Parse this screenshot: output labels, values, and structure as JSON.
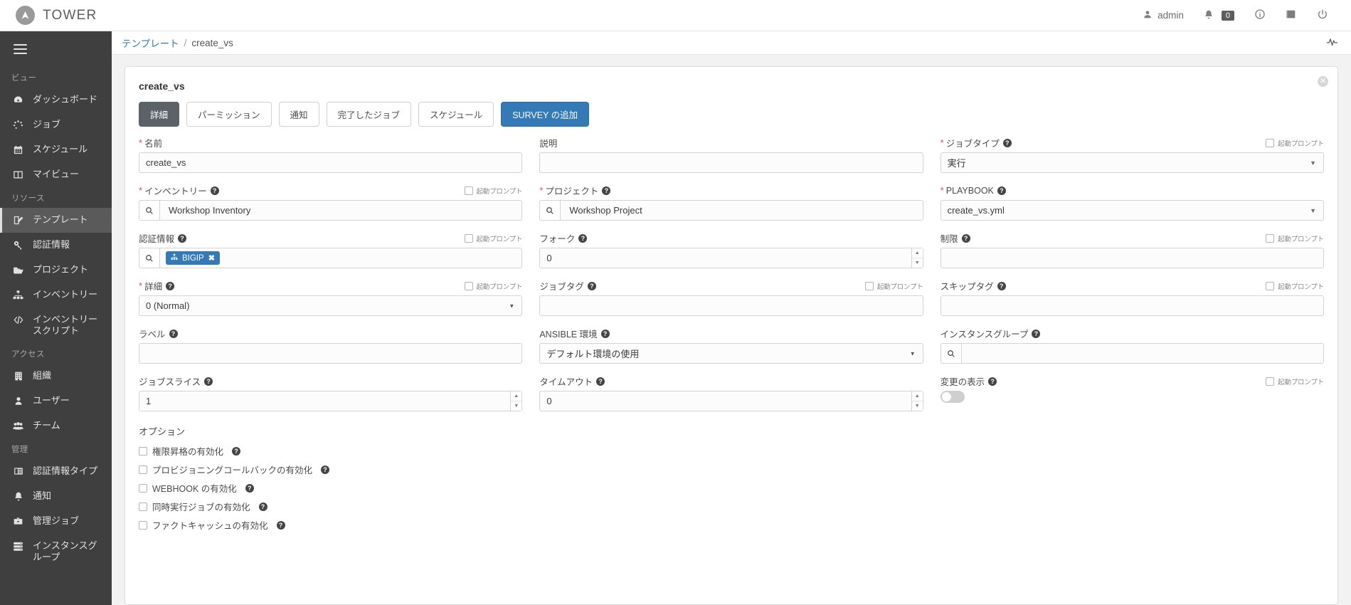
{
  "topbar": {
    "brand": "TOWER",
    "user": "admin",
    "notifications_count": "0",
    "icons": [
      "user-icon",
      "bell-icon",
      "info-icon",
      "book-icon",
      "power-icon"
    ]
  },
  "breadcrumb": {
    "root": "テンプレート",
    "separator": "/",
    "current": "create_vs"
  },
  "sidebar": {
    "sections": [
      {
        "label": "ビュー",
        "items": [
          {
            "label": "ダッシュボード",
            "icon": "dashboard-icon",
            "active": false
          },
          {
            "label": "ジョブ",
            "icon": "jobs-icon",
            "active": false
          },
          {
            "label": "スケジュール",
            "icon": "calendar-icon",
            "active": false
          },
          {
            "label": "マイビュー",
            "icon": "myview-icon",
            "active": false
          }
        ]
      },
      {
        "label": "リソース",
        "items": [
          {
            "label": "テンプレート",
            "icon": "template-icon",
            "active": true
          },
          {
            "label": "認証情報",
            "icon": "key-icon",
            "active": false
          },
          {
            "label": "プロジェクト",
            "icon": "folder-icon",
            "active": false
          },
          {
            "label": "インベントリー",
            "icon": "sitemap-icon",
            "active": false
          },
          {
            "label": "インベントリースクリプト",
            "icon": "code-icon",
            "active": false
          }
        ]
      },
      {
        "label": "アクセス",
        "items": [
          {
            "label": "組織",
            "icon": "building-icon",
            "active": false
          },
          {
            "label": "ユーザー",
            "icon": "user-icon",
            "active": false
          },
          {
            "label": "チーム",
            "icon": "team-icon",
            "active": false
          }
        ]
      },
      {
        "label": "管理",
        "items": [
          {
            "label": "認証情報タイプ",
            "icon": "credential-type-icon",
            "active": false
          },
          {
            "label": "通知",
            "icon": "bell-icon",
            "active": false
          },
          {
            "label": "管理ジョブ",
            "icon": "briefcase-icon",
            "active": false
          },
          {
            "label": "インスタンスグループ",
            "icon": "server-icon",
            "active": false
          }
        ]
      }
    ]
  },
  "card": {
    "title": "create_vs",
    "tabs": [
      {
        "label": "詳細",
        "style": "active"
      },
      {
        "label": "パーミッション",
        "style": "default"
      },
      {
        "label": "通知",
        "style": "default"
      },
      {
        "label": "完了したジョブ",
        "style": "default"
      },
      {
        "label": "スケジュール",
        "style": "default"
      },
      {
        "label": "SURVEY の追加",
        "style": "primary"
      }
    ],
    "prompt_label": "起動プロンプト",
    "fields": {
      "name": {
        "label": "名前",
        "value": "create_vs"
      },
      "description": {
        "label": "説明",
        "value": ""
      },
      "job_type": {
        "label": "ジョブタイプ",
        "value": "実行"
      },
      "inventory": {
        "label": "インベントリー",
        "value": "Workshop Inventory"
      },
      "project": {
        "label": "プロジェクト",
        "value": "Workshop Project"
      },
      "playbook": {
        "label": "PLAYBOOK",
        "value": "create_vs.yml"
      },
      "credentials": {
        "label": "認証情報",
        "tag": "BIGIP"
      },
      "forks": {
        "label": "フォーク",
        "value": "0"
      },
      "limit": {
        "label": "制限",
        "value": ""
      },
      "verbosity": {
        "label": "詳細",
        "value": "0 (Normal)"
      },
      "job_tags": {
        "label": "ジョブタグ",
        "value": ""
      },
      "skip_tags": {
        "label": "スキップタグ",
        "value": ""
      },
      "labels": {
        "label": "ラベル",
        "value": ""
      },
      "ansible_env": {
        "label": "ANSIBLE 環境",
        "value": "デフォルト環境の使用"
      },
      "instance_groups": {
        "label": "インスタンスグループ",
        "value": ""
      },
      "job_slicing": {
        "label": "ジョブスライス",
        "value": "1"
      },
      "timeout": {
        "label": "タイムアウト",
        "value": "0"
      },
      "show_changes": {
        "label": "変更の表示",
        "value": ""
      }
    },
    "options": {
      "title": "オプション",
      "items": [
        {
          "label": "権限昇格の有効化",
          "checked": false
        },
        {
          "label": "プロビジョニングコールバックの有効化",
          "checked": false
        },
        {
          "label": "WEBHOOK の有効化",
          "checked": false
        },
        {
          "label": "同時実行ジョブの有効化",
          "checked": false
        },
        {
          "label": "ファクトキャッシュの有効化",
          "checked": false
        }
      ]
    }
  },
  "colors": {
    "accent": "#337ab7",
    "sidebar": "#3f3f3f",
    "required": "#d9534f",
    "tab_active": "#5b6368"
  }
}
